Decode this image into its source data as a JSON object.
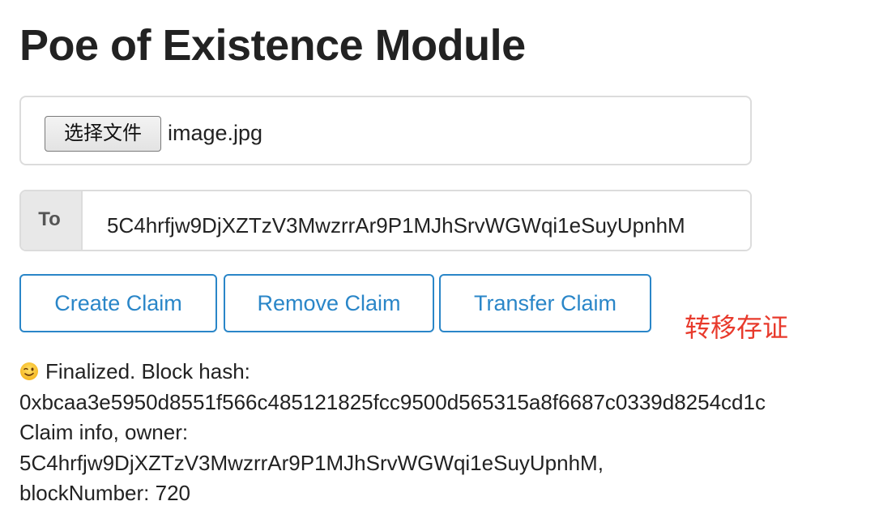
{
  "header": {
    "title": "Poe of Existence Module"
  },
  "file_input": {
    "button_label": "选择文件",
    "file_name": "image.jpg"
  },
  "to_field": {
    "label": "To",
    "value": "5C4hrfjw9DjXZTzV3MwzrrAr9P1MJhSrvWGWqi1eSuyUpnhM"
  },
  "buttons": {
    "create": "Create Claim",
    "remove": "Remove Claim",
    "transfer": "Transfer Claim"
  },
  "annotation": {
    "text": "转移存证",
    "color": "#e83a2c"
  },
  "status": {
    "icon": "wink-emoji-icon",
    "line1": "Finalized. Block hash:",
    "line2": "0xbcaa3e5950d8551f566c485121825fcc9500d565315a8f6687c0339d8254cd1c",
    "line3": "Claim info, owner:",
    "line4": "5C4hrfjw9DjXZTzV3MwzrrAr9P1MJhSrvWGWqi1eSuyUpnhM,",
    "line5": "blockNumber: 720"
  },
  "colors": {
    "accent": "#2a86c8",
    "text": "#222222",
    "border": "#dcdcdc"
  }
}
